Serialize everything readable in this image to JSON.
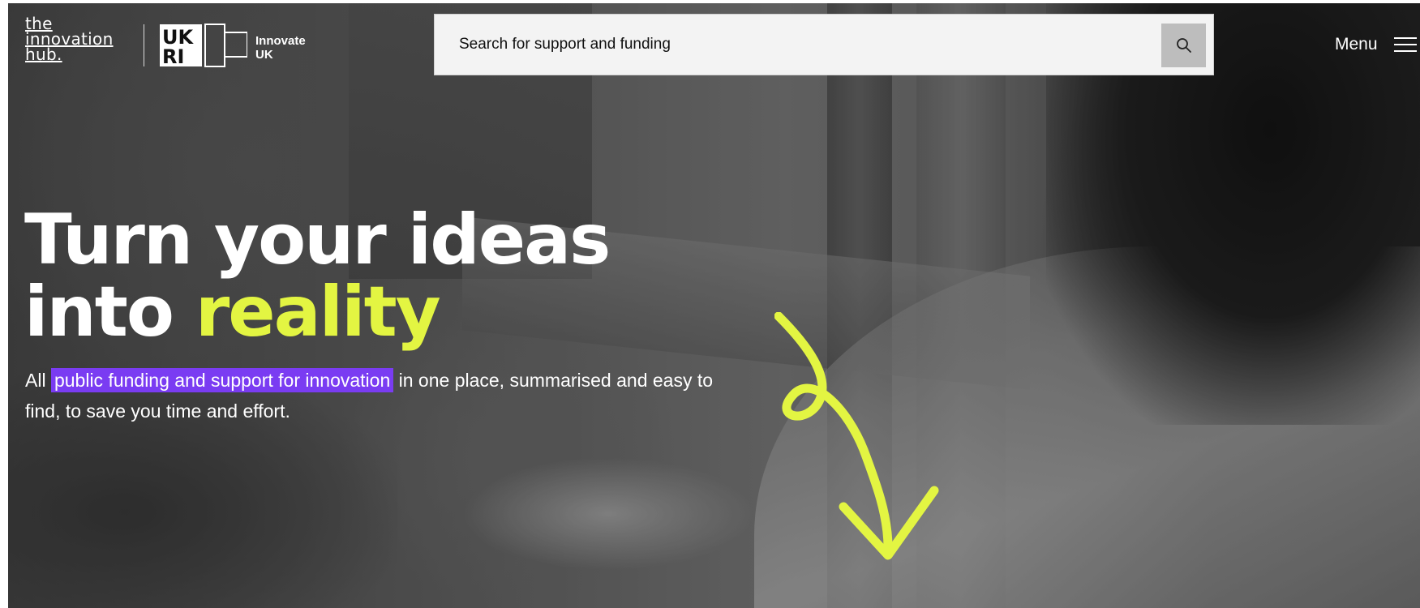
{
  "header": {
    "hub_logo_lines": [
      "the",
      "innovation",
      "hub."
    ],
    "ukri_logo_label": "UKRI",
    "innovate_lines": [
      "Innovate",
      "UK"
    ],
    "search_placeholder": "Search for support and funding",
    "menu_label": "Menu"
  },
  "hero": {
    "headline_line1": "Turn your ideas",
    "headline_line2_prefix": "into ",
    "headline_line2_accent": "reality",
    "subtitle_prefix": "All ",
    "subtitle_highlight": "public funding and support for innovation",
    "subtitle_suffix": " in one place, summarised and easy to find, to save you time and effort."
  },
  "colors": {
    "accent_yellow": "#e3f542",
    "highlight_purple": "#7a3cf2",
    "search_bg": "#f3f3f3",
    "search_button_bg": "#bdbdbd"
  },
  "icons": {
    "search": "magnifier-icon",
    "menu": "hamburger-icon",
    "arrow": "curly-down-arrow-icon"
  }
}
